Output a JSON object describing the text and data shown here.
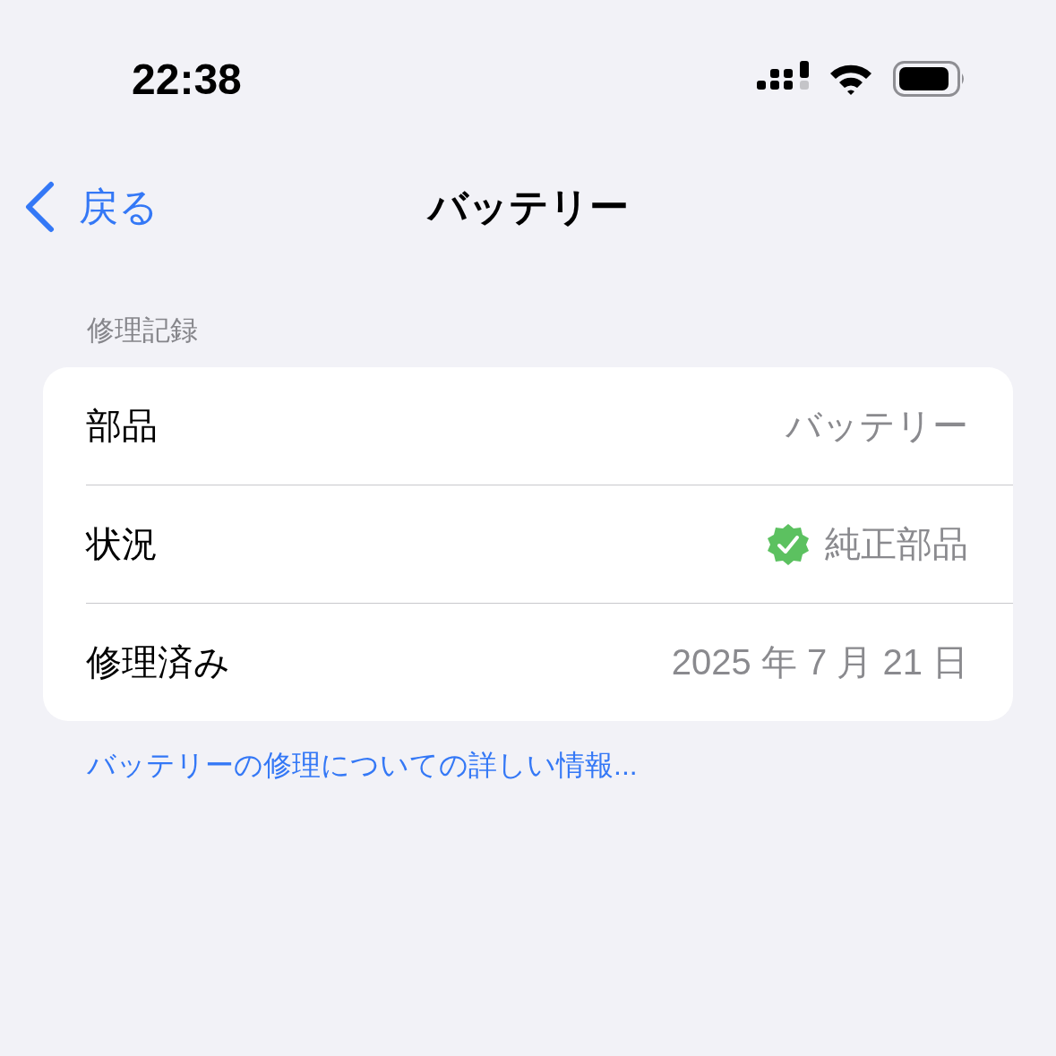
{
  "status_bar": {
    "time": "22:38"
  },
  "nav": {
    "back": "戻る",
    "title": "バッテリー"
  },
  "section": {
    "header": "修理記録",
    "rows": [
      {
        "kind": "plain",
        "label": "部品",
        "value": "バッテリー"
      },
      {
        "kind": "verified",
        "label": "状況",
        "value": "純正部品"
      },
      {
        "kind": "plain",
        "label": "修理済み",
        "value": "2025 年 7 月 21 日"
      }
    ],
    "footer_link": "バッテリーの修理についての詳しい情報..."
  }
}
